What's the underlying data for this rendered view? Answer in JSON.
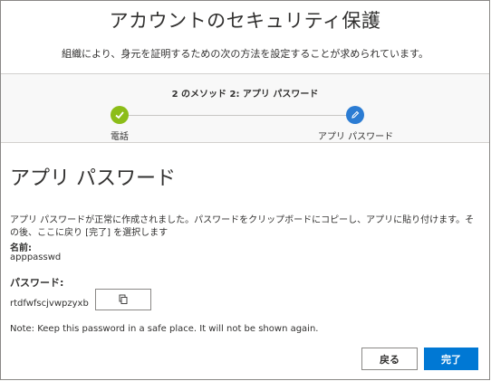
{
  "header": {
    "title": "アカウントのセキュリティ保護",
    "subtitle": "組織により、身元を証明するための次の方法を設定することが求められています。"
  },
  "steps": {
    "title": "2 のメソッド 2: アプリ パスワード",
    "items": [
      {
        "label": "電話",
        "status": "completed",
        "icon": "checkmark-icon",
        "color": "#8cbd18"
      },
      {
        "label": "アプリ パスワード",
        "status": "current",
        "icon": "pencil-icon",
        "color": "#2b7cd3"
      }
    ]
  },
  "main": {
    "section_title": "アプリ パスワード",
    "description": "アプリ パスワードが正常に作成されました。パスワードをクリップボードにコピーし、アプリに貼り付けます。その後、ここに戻り [完了] を選択します",
    "name_label": "名前:",
    "name_value": "apppasswd",
    "password_label": "パスワード:",
    "password_value": "rtdfwfscjvwpzyxb",
    "copy_icon": "copy-icon",
    "note": "Note: Keep this password in a safe place. It will not be shown again."
  },
  "actions": {
    "back_label": "戻る",
    "done_label": "完了",
    "accent": "#0078d4"
  }
}
